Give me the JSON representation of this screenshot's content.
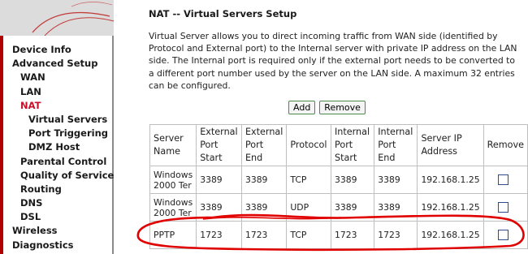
{
  "sidebar": {
    "items": [
      {
        "label": "Device Info",
        "level": 1,
        "active": false
      },
      {
        "label": "Advanced Setup",
        "level": 1,
        "active": false
      },
      {
        "label": "WAN",
        "level": 2,
        "active": false
      },
      {
        "label": "LAN",
        "level": 2,
        "active": false
      },
      {
        "label": "NAT",
        "level": 2,
        "active": true
      },
      {
        "label": "Virtual Servers",
        "level": 3,
        "active": false
      },
      {
        "label": "Port Triggering",
        "level": 3,
        "active": false
      },
      {
        "label": "DMZ Host",
        "level": 3,
        "active": false
      },
      {
        "label": "Parental Control",
        "level": 2,
        "active": false
      },
      {
        "label": "Quality of Service",
        "level": 2,
        "active": false
      },
      {
        "label": "Routing",
        "level": 2,
        "active": false
      },
      {
        "label": "DNS",
        "level": 2,
        "active": false
      },
      {
        "label": "DSL",
        "level": 2,
        "active": false
      },
      {
        "label": "Wireless",
        "level": 1,
        "active": false
      },
      {
        "label": "Diagnostics",
        "level": 1,
        "active": false
      }
    ],
    "active_color": "#c8102e",
    "border_color": "#b00000"
  },
  "main": {
    "title": "NAT -- Virtual Servers Setup",
    "description": "Virtual Server allows you to direct incoming traffic from WAN side (identified by Protocol and External port) to the Internal server with private IP address on the LAN side. The Internal port is required only if the external port needs to be converted to a different port number used by the server on the LAN side. A maximum 32 entries can be configured.",
    "add_label": "Add",
    "remove_label": "Remove"
  },
  "table": {
    "headers": [
      "Server Name",
      "External Port Start",
      "External Port End",
      "Protocol",
      "Internal Port Start",
      "Internal Port End",
      "Server IP Address",
      "Remove"
    ],
    "rows": [
      {
        "name": "Windows 2000 Ter",
        "ext_start": "3389",
        "ext_end": "3389",
        "protocol": "TCP",
        "int_start": "3389",
        "int_end": "3389",
        "ip": "192.168.1.25",
        "checked": false
      },
      {
        "name": "Windows 2000 Ter",
        "ext_start": "3389",
        "ext_end": "3389",
        "protocol": "UDP",
        "int_start": "3389",
        "int_end": "3389",
        "ip": "192.168.1.25",
        "checked": false
      },
      {
        "name": "PPTP",
        "ext_start": "1723",
        "ext_end": "1723",
        "protocol": "TCP",
        "int_start": "1723",
        "int_end": "1723",
        "ip": "192.168.1.25",
        "checked": false
      }
    ]
  },
  "annotation": {
    "color": "#e00000",
    "highlights_row": 3
  }
}
